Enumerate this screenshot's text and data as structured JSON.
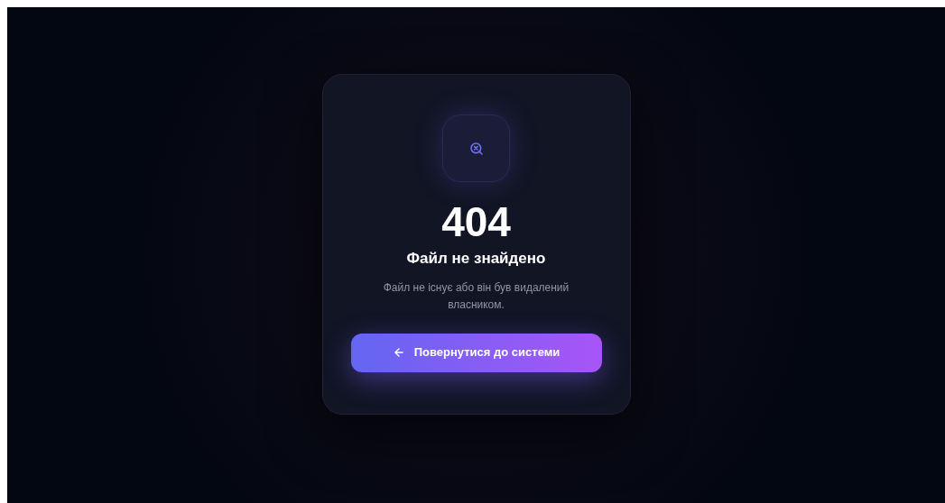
{
  "error": {
    "code": "404",
    "title": "Файл не знайдено",
    "message": "Файл не існує або він був видалений власником."
  },
  "button": {
    "label": "Повернутися до системи"
  }
}
